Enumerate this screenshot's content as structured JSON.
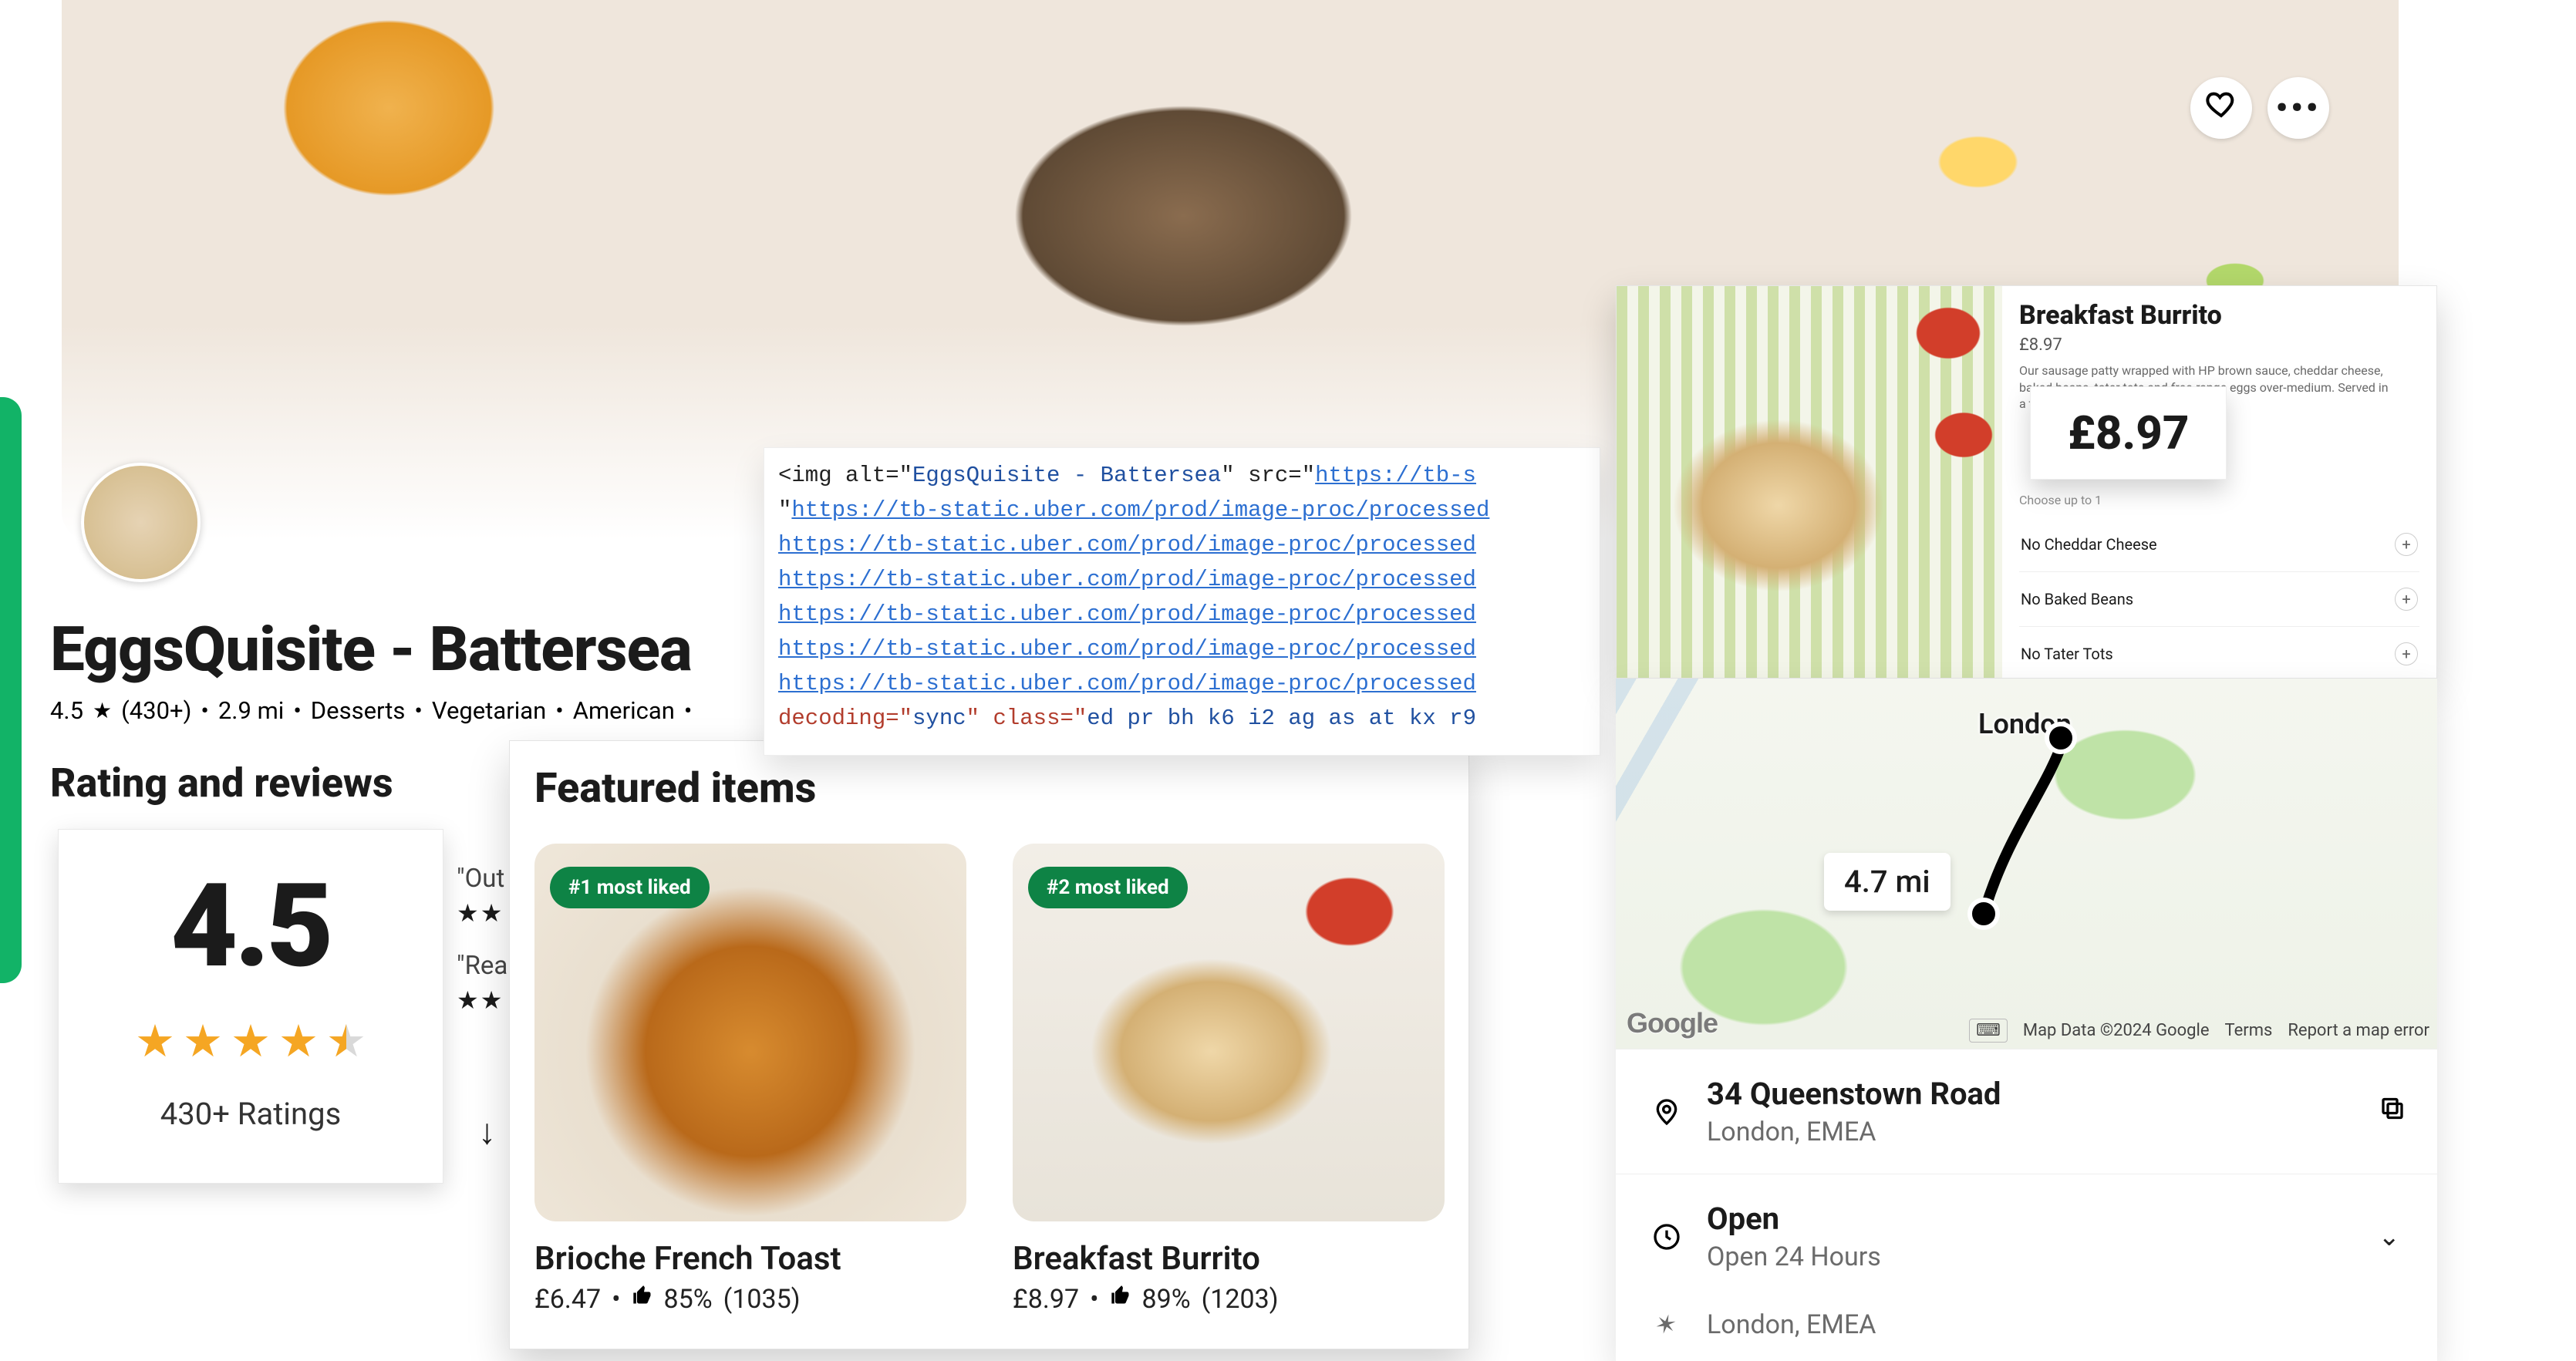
{
  "restaurant": {
    "name": "EggsQuisite - Battersea",
    "rating_value": "4.5",
    "rating_count_label": "(430+)",
    "distance": "2.9 mi",
    "tags": [
      "Desserts",
      "Vegetarian",
      "American"
    ]
  },
  "hero": {
    "favorite_icon": "heart-icon",
    "more_icon": "more-icon",
    "img_alt": "EggsQuisite - Battersea"
  },
  "reviews": {
    "heading": "Rating and reviews",
    "big_rating": "4.5",
    "count_label": "430+ Ratings",
    "snippets": [
      {
        "quote": "\"Out",
        "stars": "★★"
      },
      {
        "quote": "\"Rea",
        "stars": "★★"
      }
    ]
  },
  "featured": {
    "heading": "Featured items",
    "items": [
      {
        "badge": "#1 most liked",
        "name": "Brioche French Toast",
        "price": "£6.47",
        "like_pct": "85%",
        "like_count": "(1035)"
      },
      {
        "badge": "#2 most liked",
        "name": "Breakfast Burrito",
        "price": "£8.97",
        "like_pct": "89%",
        "like_count": "(1203)"
      }
    ]
  },
  "code_overlay": {
    "l1_pre": "<img alt=\"",
    "l1_alt": "EggsQuisite - Battersea",
    "l1_mid": "\" src=\"",
    "l1_url": "https://tb-s",
    "l2_q": "\"",
    "url_line": "https://tb-static.uber.com/prod/image-proc/processed",
    "l8_pre": "decoding=\"",
    "l8_dec": "sync",
    "l8_mid": "\" class=\"",
    "l8_cls": "ed pr bh k6 i2 ag as at kx r9"
  },
  "detail": {
    "title": "Breakfast Burrito",
    "price_small": "£8.97",
    "description": "Our sausage patty wrapped with HP brown sauce, cheddar cheese, baked beans, tater tots and free-range eggs over-medium. Served in a toasted",
    "price_big": "£8.97",
    "choose_label": "Choose up to 1",
    "options": [
      {
        "label": "No Cheddar Cheese"
      },
      {
        "label": "No Baked Beans"
      },
      {
        "label": "No Tater Tots"
      }
    ]
  },
  "map": {
    "city_label": "London",
    "distance_chip": "4.7 mi",
    "google": "Google",
    "attrib": "Map Data ©2024 Google",
    "terms": "Terms",
    "report": "Report a map error"
  },
  "location": {
    "address_line1": "34 Queenstown Road",
    "address_line2": "London, EMEA",
    "open_label": "Open",
    "hours_label": "Open 24 Hours",
    "ghost_line": "London, EMEA"
  }
}
